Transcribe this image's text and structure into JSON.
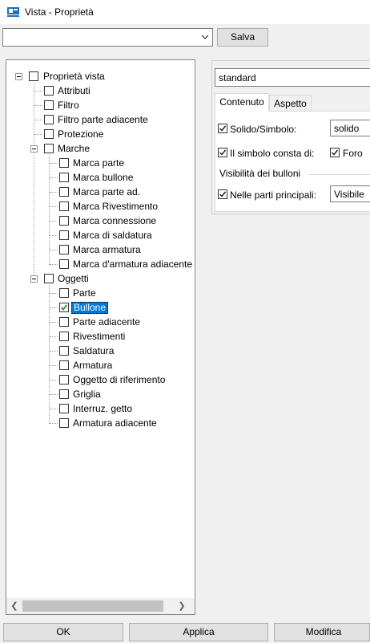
{
  "window": {
    "title": "Vista - Proprietà",
    "icon": "view-properties-icon"
  },
  "toolbar": {
    "preset_value": "",
    "save_label": "Salva"
  },
  "tree": {
    "root": {
      "label": "Proprietà vista",
      "checked": false
    },
    "items": [
      {
        "label": "Attributi",
        "checked": false
      },
      {
        "label": "Filtro",
        "checked": false
      },
      {
        "label": "Filtro parte adiacente",
        "checked": false
      },
      {
        "label": "Protezione",
        "checked": false
      },
      {
        "label": "Marche",
        "checked": false,
        "children": [
          {
            "label": "Marca parte",
            "checked": false
          },
          {
            "label": "Marca bullone",
            "checked": false
          },
          {
            "label": "Marca parte ad.",
            "checked": false
          },
          {
            "label": "Marca Rivestimento",
            "checked": false
          },
          {
            "label": "Marca connessione",
            "checked": false
          },
          {
            "label": "Marca di saldatura",
            "checked": false
          },
          {
            "label": "Marca armatura",
            "checked": false
          },
          {
            "label": "Marca d'armatura adiacente",
            "checked": false
          }
        ]
      },
      {
        "label": "Oggetti",
        "checked": false,
        "children": [
          {
            "label": "Parte",
            "checked": false
          },
          {
            "label": "Bullone",
            "checked": true,
            "selected": true
          },
          {
            "label": "Parte adiacente",
            "checked": false
          },
          {
            "label": "Rivestimenti",
            "checked": false
          },
          {
            "label": "Saldatura",
            "checked": false
          },
          {
            "label": "Armatura",
            "checked": false
          },
          {
            "label": "Oggetto di riferimento",
            "checked": false
          },
          {
            "label": "Griglia",
            "checked": false
          },
          {
            "label": "Interruz. getto",
            "checked": false
          },
          {
            "label": "Armatura adiacente",
            "checked": false
          }
        ]
      }
    ]
  },
  "properties": {
    "preset": "standard",
    "tabs": [
      {
        "label": "Contenuto",
        "active": true
      },
      {
        "label": "Aspetto",
        "active": false
      }
    ],
    "solid_symbol": {
      "label": "Solido/Simbolo:",
      "checked": true,
      "value": "solido"
    },
    "symbol_contains": {
      "label": "Il simbolo consta di:",
      "checked": true,
      "hole_label": "Foro",
      "hole_checked": true
    },
    "bolt_visibility": {
      "group_label": "Visibilità dei bulloni",
      "main_parts_label": "Nelle parti principali:",
      "main_parts_checked": true,
      "main_parts_value": "Visibile"
    }
  },
  "footer": {
    "ok_label": "OK",
    "apply_label": "Applica",
    "modify_label": "Modifica"
  },
  "colors": {
    "selection": "#0078d7",
    "check_green": "#2e8b2e",
    "check_dark": "#1a1a1a"
  }
}
